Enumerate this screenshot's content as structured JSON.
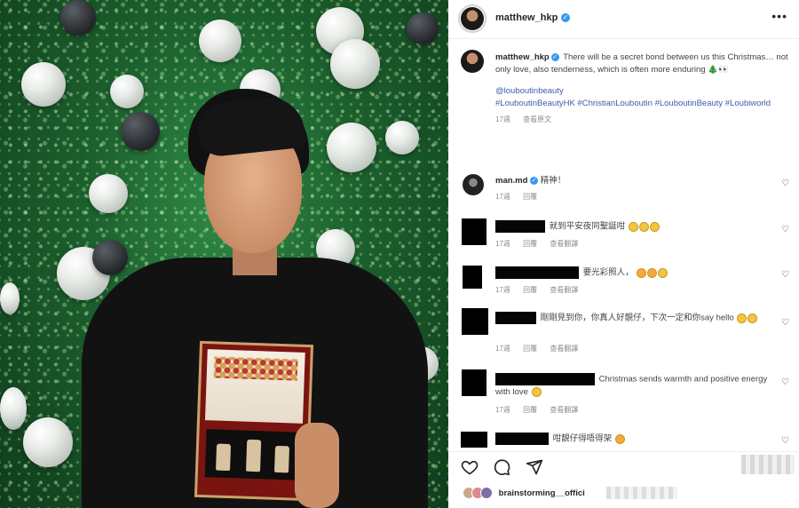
{
  "post": {
    "author": "matthew_hkp",
    "more_label": "•••",
    "caption_text": "There will be a secret bond between us this Christmas… not only love, also tenderness, which is often more enduring",
    "caption_emoji": "🎄👀",
    "mention": "@louboutinbeauty",
    "hashtags": "#LouboutinBeautyHK #ChristianLouboutin #LouboutinBeauty #Loubiworld",
    "time": "17週",
    "see_translation": "查看原文"
  },
  "comments": [
    {
      "user": "man.md",
      "text": "精神！",
      "time": "17週",
      "reply": "回覆",
      "see": ""
    },
    {
      "user": "",
      "text": "就到平安夜同聖誕咁",
      "time": "17週",
      "reply": "回覆",
      "see": "查看翻譯"
    },
    {
      "user": "",
      "text": "要光彩照人，",
      "time": "17週",
      "reply": "回覆",
      "see": "查看翻譯"
    },
    {
      "user": "",
      "text": "剛剛見到你，你真人好靚仔，下次一定和你say hello",
      "time": "17週",
      "reply": "回覆",
      "see": "查看翻譯"
    },
    {
      "user": "",
      "text": "Christmas sends warmth and positive energy with love",
      "time": "17週",
      "reply": "回覆",
      "see": "查看翻譯"
    },
    {
      "user": "",
      "text": "咁靚仔得唔得架",
      "time": "",
      "reply": "",
      "see": ""
    }
  ],
  "likes": {
    "first_user": "brainstorming__offici"
  },
  "colors": {
    "verified": "#3897f0",
    "link": "#3b5ea8",
    "secondary_text": "#8e8e8e"
  },
  "icons": [
    "heart-icon",
    "comment-icon",
    "share-icon",
    "more-icon",
    "verified-icon"
  ]
}
